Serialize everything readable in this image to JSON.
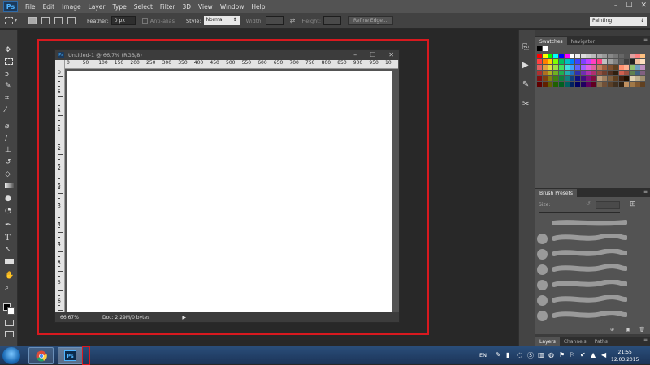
{
  "app": {
    "logo": "Ps"
  },
  "menu": [
    "File",
    "Edit",
    "Image",
    "Layer",
    "Type",
    "Select",
    "Filter",
    "3D",
    "View",
    "Window",
    "Help"
  ],
  "window_controls": {
    "minimize": "–",
    "restore": "☐",
    "close": "✕"
  },
  "options": {
    "feather_label": "Feather:",
    "feather_value": "0 px",
    "antialias_label": "Anti-alias",
    "style_label": "Style:",
    "style_value": "Normal",
    "width_label": "Width:",
    "height_label": "Height:",
    "refine_edge": "Refine Edge..."
  },
  "workspace": "Painting",
  "document": {
    "title": "Untitled-1 @ 66,7% (RGB/8)",
    "zoom": "66.67%",
    "doc_info": "Doc: 2,29M/0 bytes",
    "ruler_top": [
      "0",
      "50",
      "100",
      "150",
      "200",
      "250",
      "300",
      "350",
      "400",
      "450",
      "500",
      "550",
      "600",
      "650",
      "700",
      "750",
      "800",
      "850",
      "900",
      "950",
      "10"
    ],
    "ruler_left": [
      "0",
      "5",
      "1",
      "1",
      "2",
      "2",
      "3",
      "3",
      "4",
      "4",
      "5",
      "5",
      "6"
    ]
  },
  "panels": {
    "swatches_tab": "Swatches",
    "navigator_tab": "Navigator",
    "brush_presets_tab": "Brush Presets",
    "size_label": "Size:",
    "layers_tab": "Layers",
    "channels_tab": "Channels",
    "paths_tab": "Paths"
  },
  "taskbar": {
    "lang": "EN",
    "time": "21:55",
    "date": "12.03.2015"
  },
  "colors": {
    "highlight": "#d8191f",
    "accent": "#4eb4ff"
  }
}
